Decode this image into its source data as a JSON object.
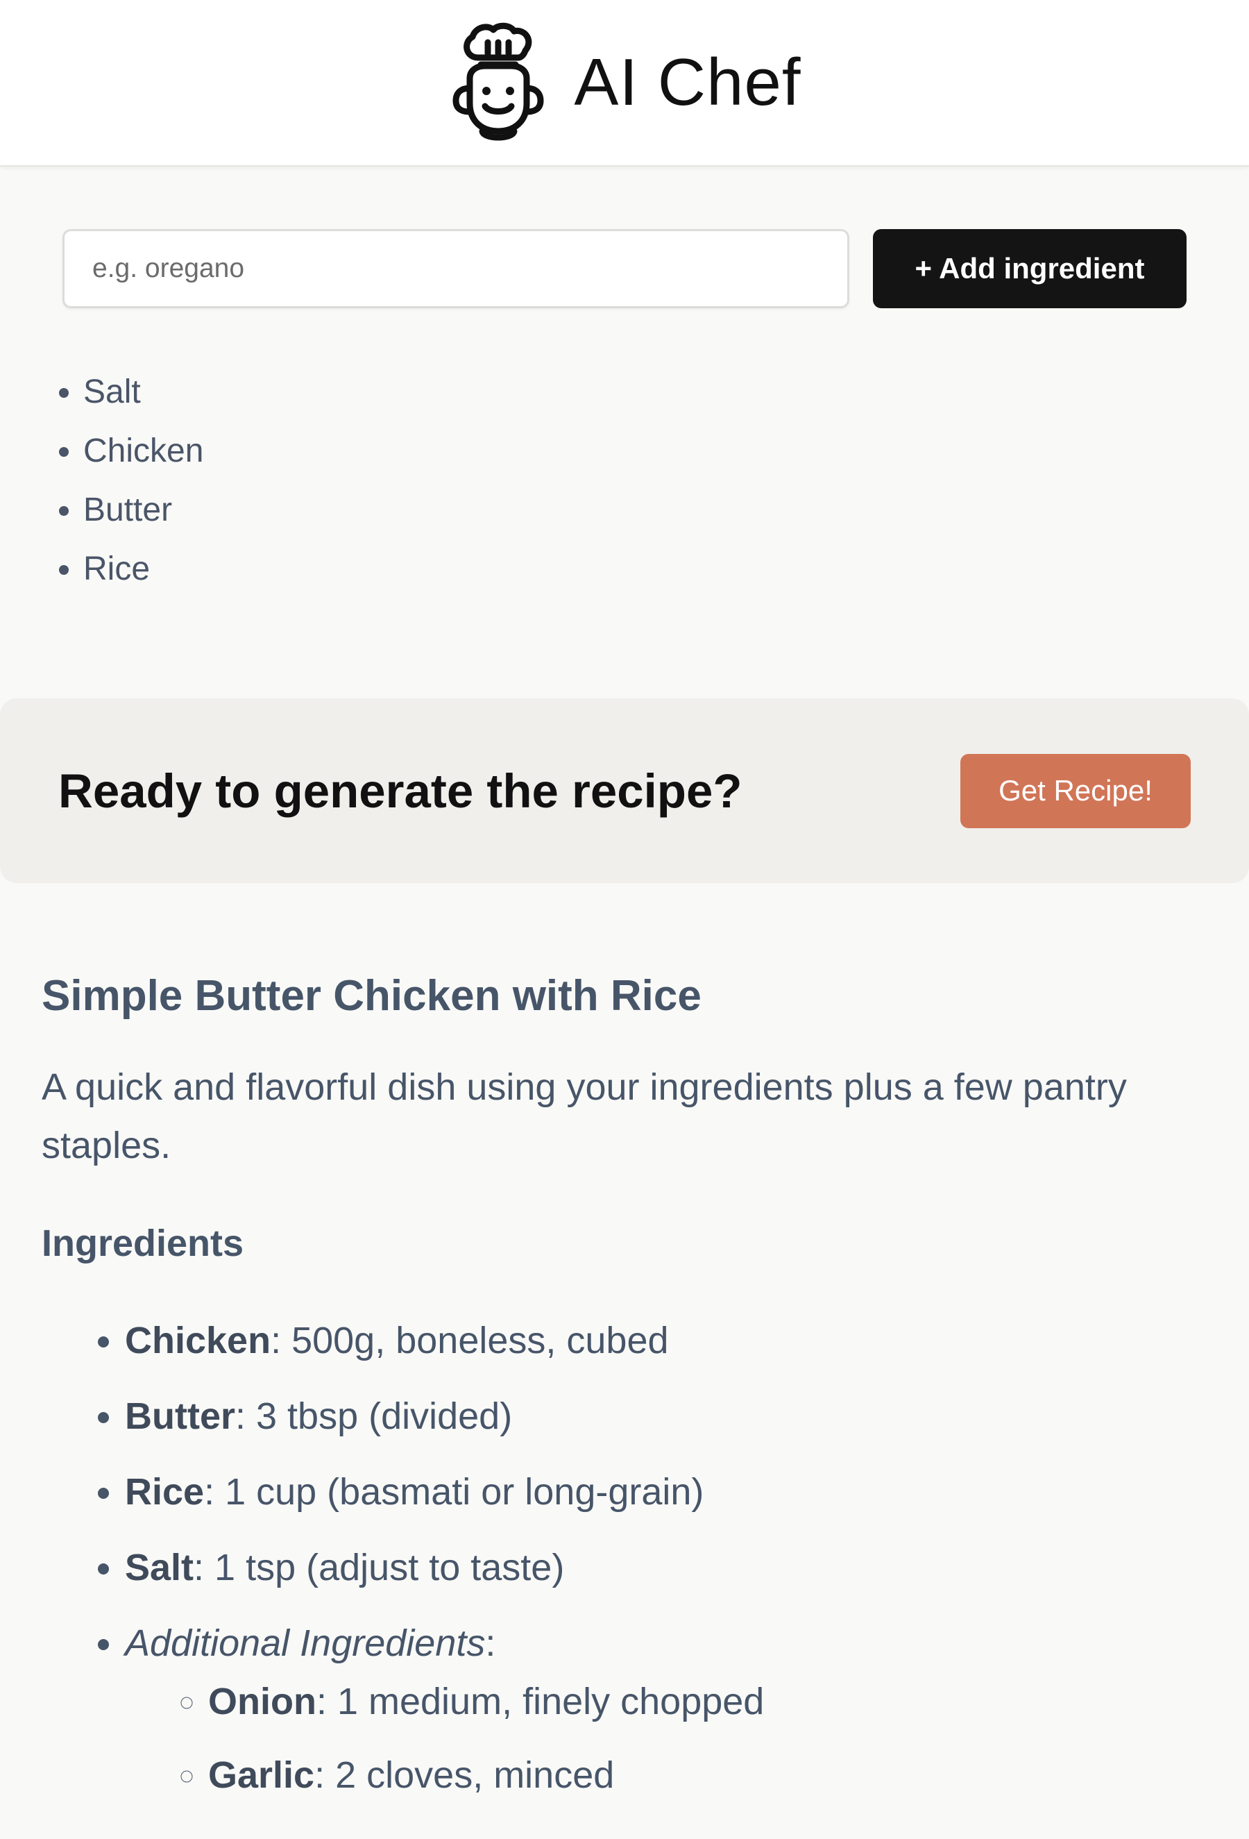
{
  "header": {
    "logo_icon": "robot-chef-icon",
    "title": "AI Chef"
  },
  "add_form": {
    "placeholder": "e.g. oregano",
    "value": "",
    "button_label": "+ Add ingredient"
  },
  "ingredients": [
    "Salt",
    "Chicken",
    "Butter",
    "Rice"
  ],
  "cta": {
    "heading": "Ready to generate the recipe?",
    "button_label": "Get Recipe!",
    "button_color": "#d17557"
  },
  "recipe": {
    "title": "Simple Butter Chicken with Rice",
    "description": "A quick and flavorful dish using your ingredients plus a few pantry staples.",
    "ingredients_heading": "Ingredients",
    "items": [
      {
        "name": "Chicken",
        "detail": ": 500g, boneless, cubed"
      },
      {
        "name": "Butter",
        "detail": ": 3 tbsp (divided)"
      },
      {
        "name": "Rice",
        "detail": ": 1 cup (basmati or long-grain)"
      },
      {
        "name": "Salt",
        "detail": ": 1 tsp (adjust to taste)"
      }
    ],
    "additional_label": "Additional Ingredients",
    "additional_suffix": ":",
    "additional_items": [
      {
        "name": "Onion",
        "detail": ": 1 medium, finely chopped"
      },
      {
        "name": "Garlic",
        "detail": ": 2 cloves, minced"
      }
    ]
  }
}
